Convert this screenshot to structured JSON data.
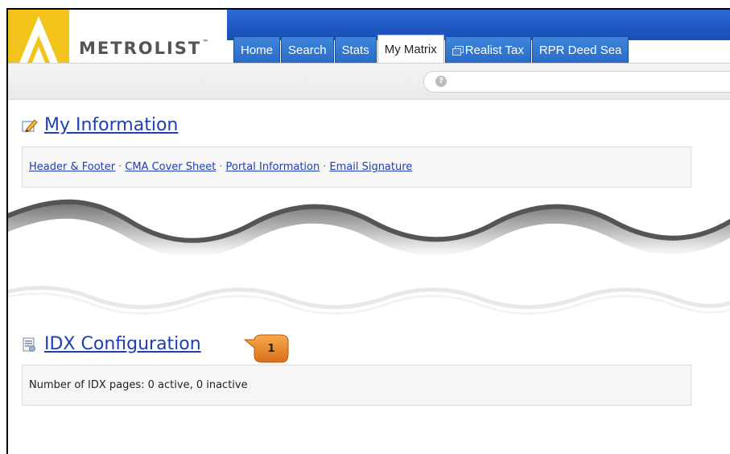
{
  "brand": {
    "name": "METROLIST",
    "trademark": "™"
  },
  "tabs": [
    {
      "label": "Home",
      "active": false
    },
    {
      "label": "Search",
      "active": false
    },
    {
      "label": "Stats",
      "active": false
    },
    {
      "label": "My Matrix",
      "active": true
    },
    {
      "label": "Realist Tax",
      "active": false,
      "icon": "external-window-icon"
    },
    {
      "label": "RPR Deed Sea",
      "active": false
    }
  ],
  "toolbar": {
    "help_icon": "help-icon",
    "help_glyph": "?"
  },
  "my_information": {
    "title": "My Information",
    "icon": "pencil-edit-icon",
    "links": [
      "Header & Footer",
      "CMA Cover Sheet",
      "Portal Information",
      "Email Signature"
    ],
    "separator": "·"
  },
  "idx_configuration": {
    "title": "IDX Configuration",
    "icon": "document-list-icon",
    "status_text": "Number of IDX pages: 0 active, 0 inactive",
    "callout_number": "1"
  },
  "colors": {
    "tab_blue": "#2a6bc7",
    "link_blue": "#1e3fb0",
    "logo_yellow": "#f2c31b",
    "callout_orange": "#e8861e"
  }
}
